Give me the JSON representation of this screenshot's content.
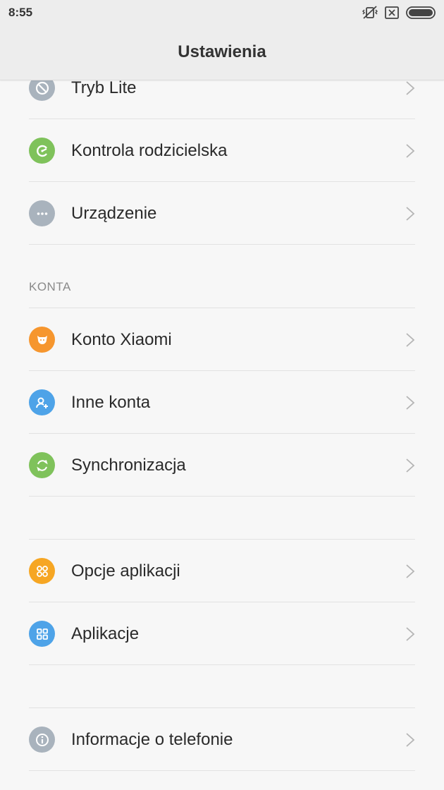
{
  "status_bar": {
    "time": "8:55"
  },
  "header": {
    "title": "Ustawienia"
  },
  "groups": {
    "top": [
      {
        "label": "Tryb Lite",
        "icon": "lite-mode-icon",
        "color": "#a9b3bd"
      },
      {
        "label": "Kontrola rodzicielska",
        "icon": "parental-control-icon",
        "color": "#7fc25b"
      },
      {
        "label": "Urządzenie",
        "icon": "more-dots-icon",
        "color": "#a9b3bd"
      }
    ],
    "accounts": {
      "header": "KONTA",
      "items": [
        {
          "label": "Konto Xiaomi",
          "icon": "mi-account-icon",
          "color": "#f6962e"
        },
        {
          "label": "Inne konta",
          "icon": "add-user-icon",
          "color": "#4ea3e8"
        },
        {
          "label": "Synchronizacja",
          "icon": "sync-icon",
          "color": "#7fc25b"
        }
      ]
    },
    "apps": [
      {
        "label": "Opcje aplikacji",
        "icon": "app-options-icon",
        "color": "#f6a623"
      },
      {
        "label": "Aplikacje",
        "icon": "apps-grid-icon",
        "color": "#4ea3e8"
      }
    ],
    "about": [
      {
        "label": "Informacje o telefonie",
        "icon": "info-icon",
        "color": "#a9b3bd"
      }
    ]
  }
}
